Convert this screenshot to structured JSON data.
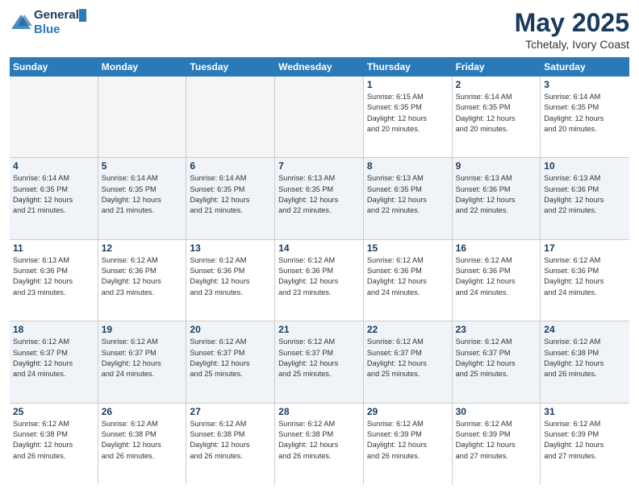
{
  "header": {
    "logo_line1": "General",
    "logo_line2": "Blue",
    "month_title": "May 2025",
    "location": "Tchetaly, Ivory Coast"
  },
  "day_headers": [
    "Sunday",
    "Monday",
    "Tuesday",
    "Wednesday",
    "Thursday",
    "Friday",
    "Saturday"
  ],
  "weeks": [
    [
      {
        "num": "",
        "empty": true
      },
      {
        "num": "",
        "empty": true
      },
      {
        "num": "",
        "empty": true
      },
      {
        "num": "",
        "empty": true
      },
      {
        "num": "1",
        "info": "Sunrise: 6:15 AM\nSunset: 6:35 PM\nDaylight: 12 hours\nand 20 minutes."
      },
      {
        "num": "2",
        "info": "Sunrise: 6:14 AM\nSunset: 6:35 PM\nDaylight: 12 hours\nand 20 minutes."
      },
      {
        "num": "3",
        "info": "Sunrise: 6:14 AM\nSunset: 6:35 PM\nDaylight: 12 hours\nand 20 minutes."
      }
    ],
    [
      {
        "num": "4",
        "info": "Sunrise: 6:14 AM\nSunset: 6:35 PM\nDaylight: 12 hours\nand 21 minutes."
      },
      {
        "num": "5",
        "info": "Sunrise: 6:14 AM\nSunset: 6:35 PM\nDaylight: 12 hours\nand 21 minutes."
      },
      {
        "num": "6",
        "info": "Sunrise: 6:14 AM\nSunset: 6:35 PM\nDaylight: 12 hours\nand 21 minutes."
      },
      {
        "num": "7",
        "info": "Sunrise: 6:13 AM\nSunset: 6:35 PM\nDaylight: 12 hours\nand 22 minutes."
      },
      {
        "num": "8",
        "info": "Sunrise: 6:13 AM\nSunset: 6:35 PM\nDaylight: 12 hours\nand 22 minutes."
      },
      {
        "num": "9",
        "info": "Sunrise: 6:13 AM\nSunset: 6:36 PM\nDaylight: 12 hours\nand 22 minutes."
      },
      {
        "num": "10",
        "info": "Sunrise: 6:13 AM\nSunset: 6:36 PM\nDaylight: 12 hours\nand 22 minutes."
      }
    ],
    [
      {
        "num": "11",
        "info": "Sunrise: 6:13 AM\nSunset: 6:36 PM\nDaylight: 12 hours\nand 23 minutes."
      },
      {
        "num": "12",
        "info": "Sunrise: 6:12 AM\nSunset: 6:36 PM\nDaylight: 12 hours\nand 23 minutes."
      },
      {
        "num": "13",
        "info": "Sunrise: 6:12 AM\nSunset: 6:36 PM\nDaylight: 12 hours\nand 23 minutes."
      },
      {
        "num": "14",
        "info": "Sunrise: 6:12 AM\nSunset: 6:36 PM\nDaylight: 12 hours\nand 23 minutes."
      },
      {
        "num": "15",
        "info": "Sunrise: 6:12 AM\nSunset: 6:36 PM\nDaylight: 12 hours\nand 24 minutes."
      },
      {
        "num": "16",
        "info": "Sunrise: 6:12 AM\nSunset: 6:36 PM\nDaylight: 12 hours\nand 24 minutes."
      },
      {
        "num": "17",
        "info": "Sunrise: 6:12 AM\nSunset: 6:36 PM\nDaylight: 12 hours\nand 24 minutes."
      }
    ],
    [
      {
        "num": "18",
        "info": "Sunrise: 6:12 AM\nSunset: 6:37 PM\nDaylight: 12 hours\nand 24 minutes."
      },
      {
        "num": "19",
        "info": "Sunrise: 6:12 AM\nSunset: 6:37 PM\nDaylight: 12 hours\nand 24 minutes."
      },
      {
        "num": "20",
        "info": "Sunrise: 6:12 AM\nSunset: 6:37 PM\nDaylight: 12 hours\nand 25 minutes."
      },
      {
        "num": "21",
        "info": "Sunrise: 6:12 AM\nSunset: 6:37 PM\nDaylight: 12 hours\nand 25 minutes."
      },
      {
        "num": "22",
        "info": "Sunrise: 6:12 AM\nSunset: 6:37 PM\nDaylight: 12 hours\nand 25 minutes."
      },
      {
        "num": "23",
        "info": "Sunrise: 6:12 AM\nSunset: 6:37 PM\nDaylight: 12 hours\nand 25 minutes."
      },
      {
        "num": "24",
        "info": "Sunrise: 6:12 AM\nSunset: 6:38 PM\nDaylight: 12 hours\nand 26 minutes."
      }
    ],
    [
      {
        "num": "25",
        "info": "Sunrise: 6:12 AM\nSunset: 6:38 PM\nDaylight: 12 hours\nand 26 minutes."
      },
      {
        "num": "26",
        "info": "Sunrise: 6:12 AM\nSunset: 6:38 PM\nDaylight: 12 hours\nand 26 minutes."
      },
      {
        "num": "27",
        "info": "Sunrise: 6:12 AM\nSunset: 6:38 PM\nDaylight: 12 hours\nand 26 minutes."
      },
      {
        "num": "28",
        "info": "Sunrise: 6:12 AM\nSunset: 6:38 PM\nDaylight: 12 hours\nand 26 minutes."
      },
      {
        "num": "29",
        "info": "Sunrise: 6:12 AM\nSunset: 6:39 PM\nDaylight: 12 hours\nand 26 minutes."
      },
      {
        "num": "30",
        "info": "Sunrise: 6:12 AM\nSunset: 6:39 PM\nDaylight: 12 hours\nand 27 minutes."
      },
      {
        "num": "31",
        "info": "Sunrise: 6:12 AM\nSunset: 6:39 PM\nDaylight: 12 hours\nand 27 minutes."
      }
    ]
  ]
}
